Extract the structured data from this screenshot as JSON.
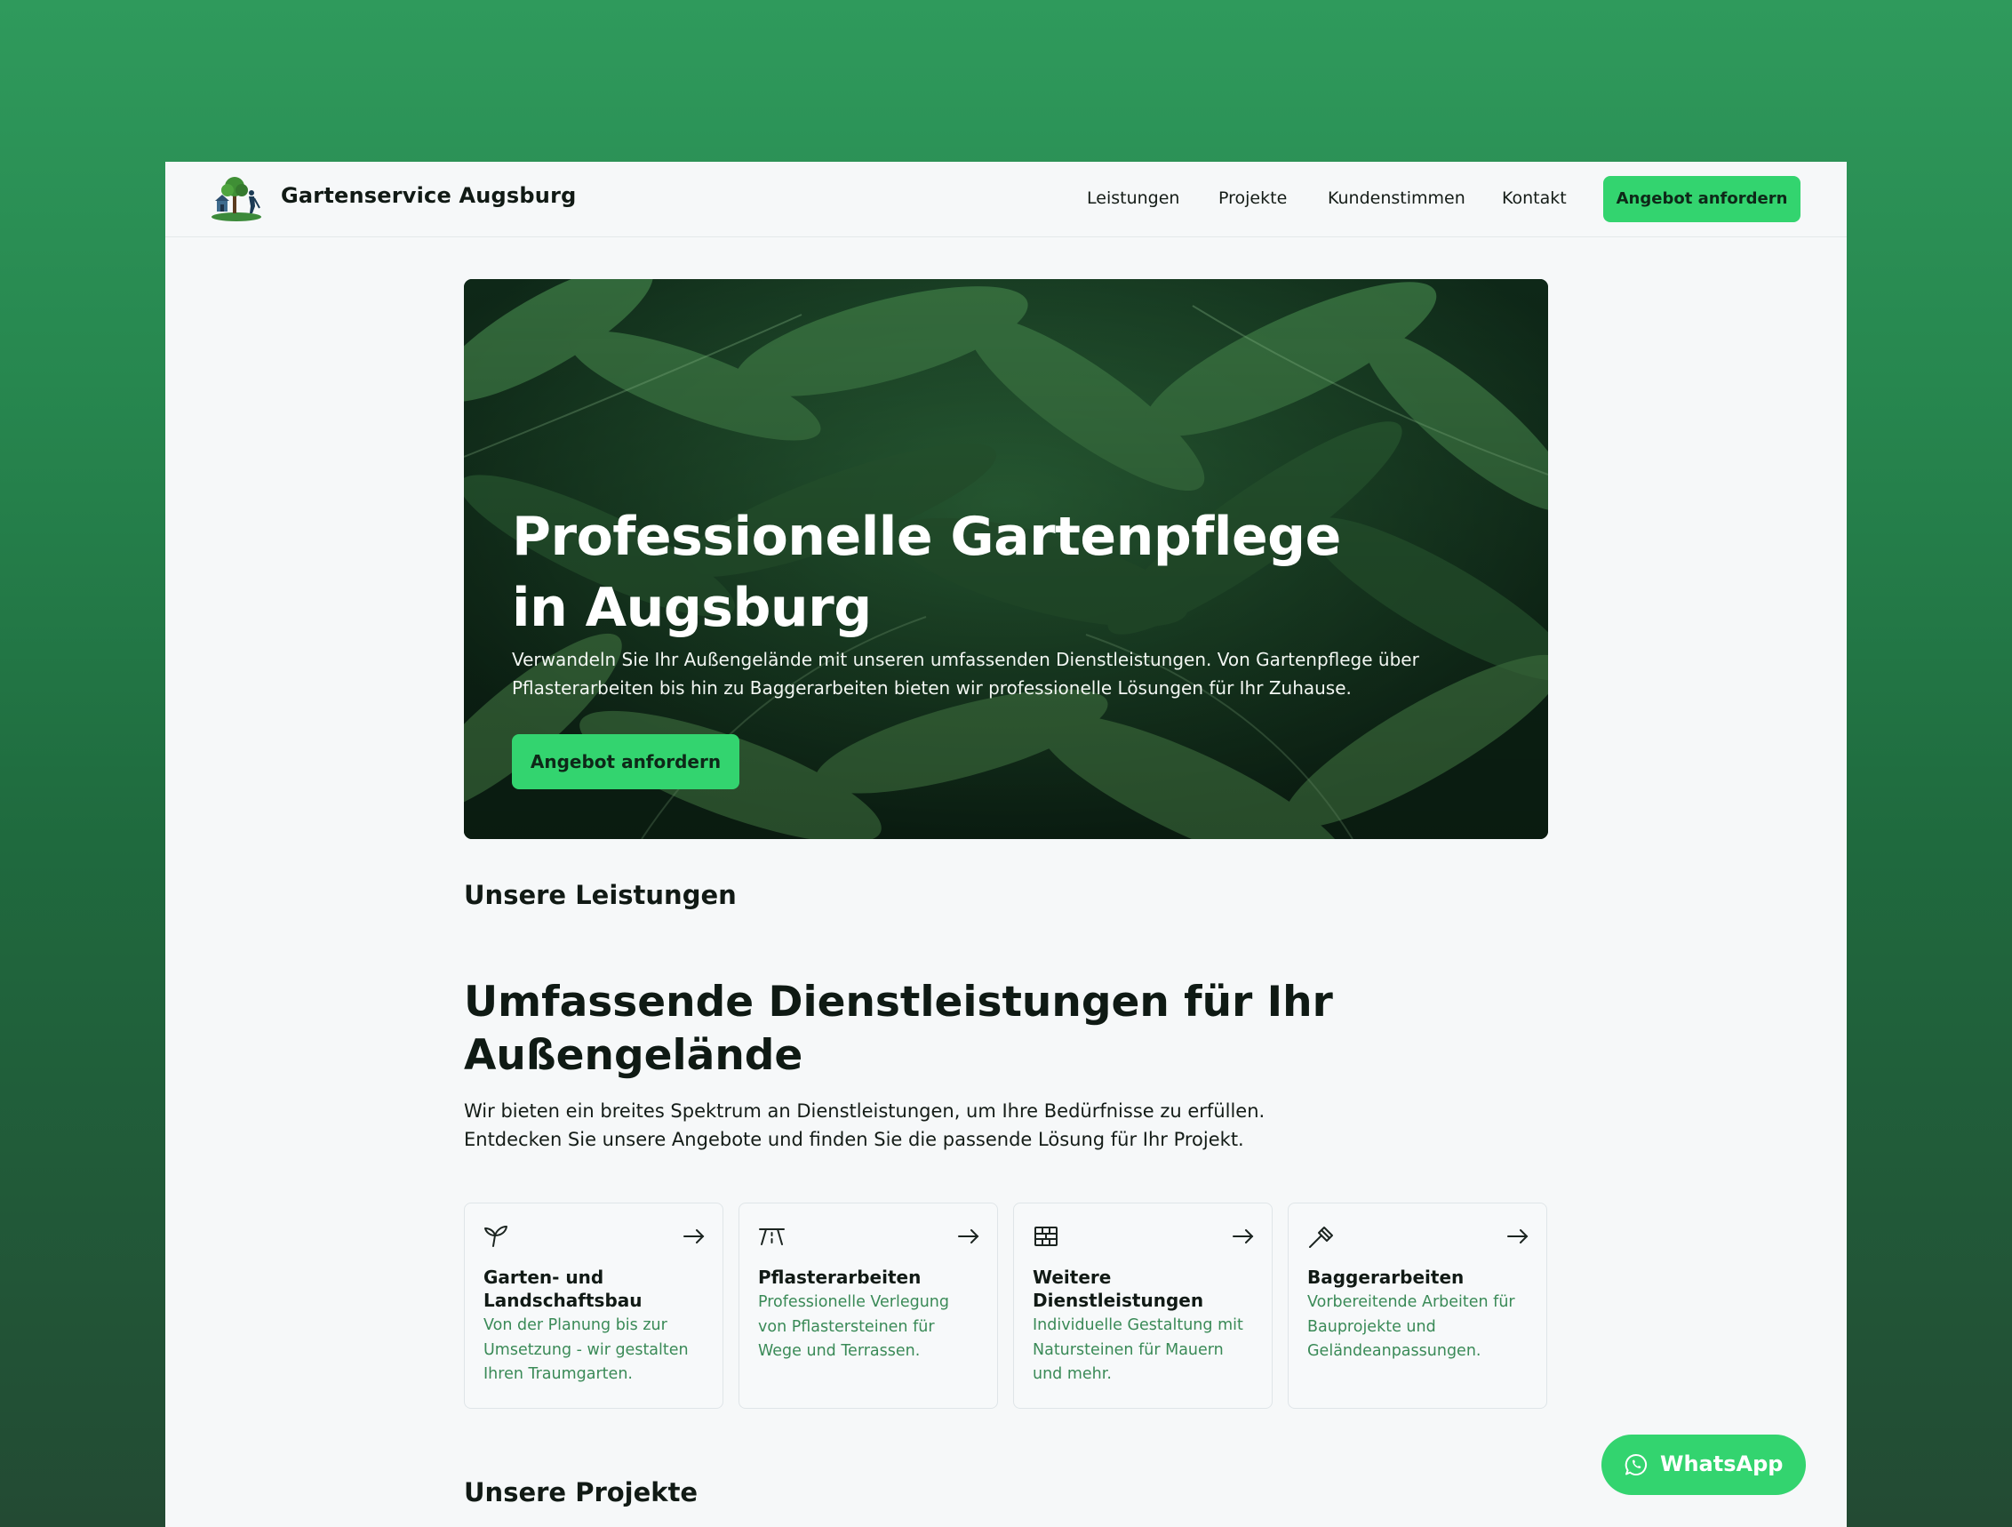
{
  "brand": {
    "name": "Gartenservice Augsburg"
  },
  "nav": {
    "items": [
      "Leistungen",
      "Projekte",
      "Kundenstimmen",
      "Kontakt"
    ],
    "cta": "Angebot anfordern"
  },
  "hero": {
    "title": "Professionelle Gartenpflege in Augsburg",
    "subtitle": "Verwandeln Sie Ihr Außengelände mit unseren umfassenden Dienstleistungen. Von Gartenpflege über Pflasterarbeiten bis hin zu Baggerarbeiten bieten wir professionelle Lösungen für Ihr Zuhause.",
    "cta": "Angebot anfordern"
  },
  "services": {
    "label": "Unsere Leistungen",
    "heading": "Umfassende Dienstleistungen für Ihr Außengelände",
    "intro": "Wir bieten ein breites Spektrum an Dienstleistungen, um Ihre Bedürfnisse zu erfüllen. Entdecken Sie unsere Angebote und finden Sie die passende Lösung für Ihr Projekt.",
    "cards": [
      {
        "icon": "sprout-icon",
        "title": "Garten- und Landschaftsbau",
        "description": "Von der Planung bis zur Umsetzung - wir gestalten Ihren Traumgarten."
      },
      {
        "icon": "paving-icon",
        "title": "Pflasterarbeiten",
        "description": "Professionelle Verlegung von Pflastersteinen für Wege und Terrassen."
      },
      {
        "icon": "brick-wall-icon",
        "title": "Weitere Dienstleistungen",
        "description": "Individuelle Gestaltung mit Natursteinen für Mauern und mehr."
      },
      {
        "icon": "hammer-icon",
        "title": "Baggerarbeiten",
        "description": "Vorbereitende Arbeiten für Bauprojekte und Geländeanpassungen."
      }
    ]
  },
  "projects": {
    "label": "Unsere Projekte"
  },
  "whatsapp": {
    "label": "WhatsApp"
  },
  "colors": {
    "accent": "#33d46f",
    "background_gradient_top": "#2f9a5c",
    "background_gradient_bottom": "#234a33",
    "description_green": "#3a8a57"
  }
}
